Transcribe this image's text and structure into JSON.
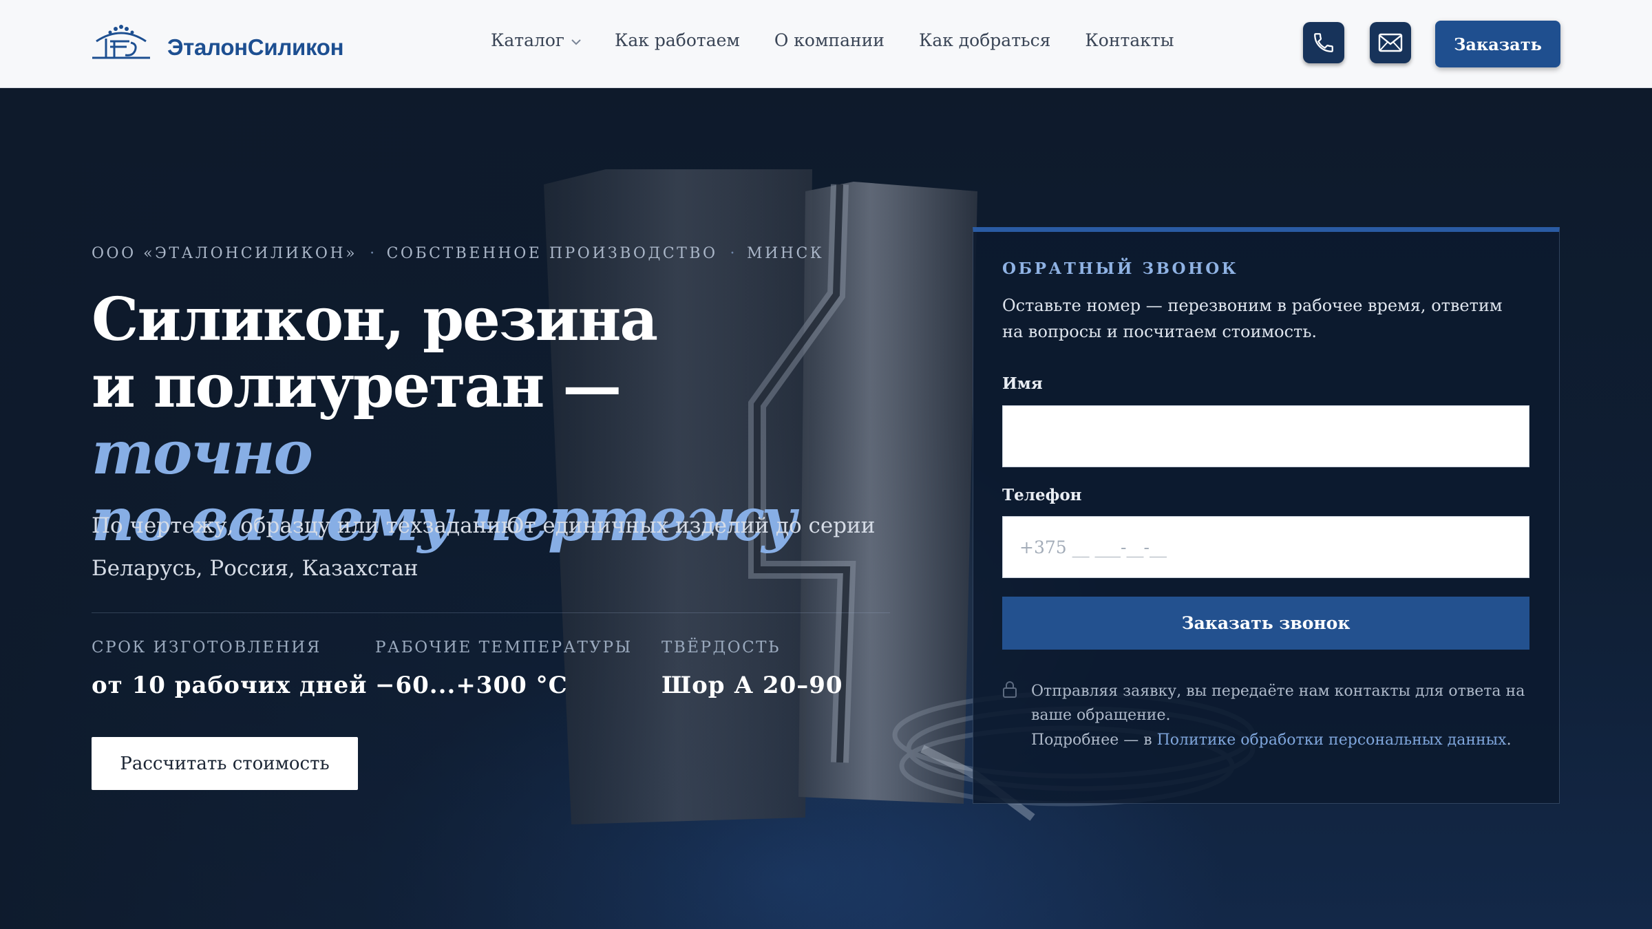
{
  "brand": {
    "name": "ЭталонСиликон"
  },
  "nav": {
    "catalog": "Каталог",
    "how_we_work": "Как работаем",
    "about": "О компании",
    "directions": "Как добраться",
    "contacts": "Контакты"
  },
  "header": {
    "order_label": "Заказать"
  },
  "hero": {
    "eyebrow": {
      "company": "ООО «ЭТАЛОНСИЛИКОН»",
      "production": "СОБСТВЕННОЕ ПРОИЗВОДСТВО",
      "city": "МИНСК",
      "separator": "·"
    },
    "headline": {
      "line1": "Силикон, резина",
      "line2_plain": "и полиуретан — ",
      "line2_accent": "точно",
      "line3_accent": "по вашему чертежу"
    },
    "tags": [
      "По чертежу, образцу или техзаданию",
      "От единичных изделий до серии",
      "Беларусь, Россия, Казахстан"
    ],
    "stats": [
      {
        "label": "СРОК ИЗГОТОВЛЕНИЯ",
        "value": "от 10 рабочих дней"
      },
      {
        "label": "РАБОЧИЕ ТЕМПЕРАТУРЫ",
        "value": "−60...+300 °C"
      },
      {
        "label": "ТВЁРДОСТЬ",
        "value": "Шор А 20–90"
      }
    ],
    "cta_label": "Рассчитать стоимость"
  },
  "callback": {
    "title": "ОБРАТНЫЙ ЗВОНОК",
    "description": "Оставьте номер — перезвоним в рабочее время, ответим на вопросы и посчитаем стоимость.",
    "name_label": "Имя",
    "name_value": "",
    "phone_label": "Телефон",
    "phone_placeholder": "+375 __ ___-__-__",
    "submit_label": "Заказать звонок",
    "consent_text": "Отправляя заявку, вы передаёте нам контакты для ответа на ваше обращение.",
    "consent_more_prefix": "Подробнее — в ",
    "consent_link": "Политике обработки персональных данных",
    "consent_suffix": "."
  },
  "colors": {
    "brand_blue": "#1d4f91",
    "accent_italic": "#87aee5",
    "panel_top_border": "#2a5ba3",
    "button_dark": "#17335a"
  },
  "icons": [
    "logo-emblem-icon",
    "chevron-down-icon",
    "phone-icon",
    "mail-icon",
    "lock-icon"
  ]
}
